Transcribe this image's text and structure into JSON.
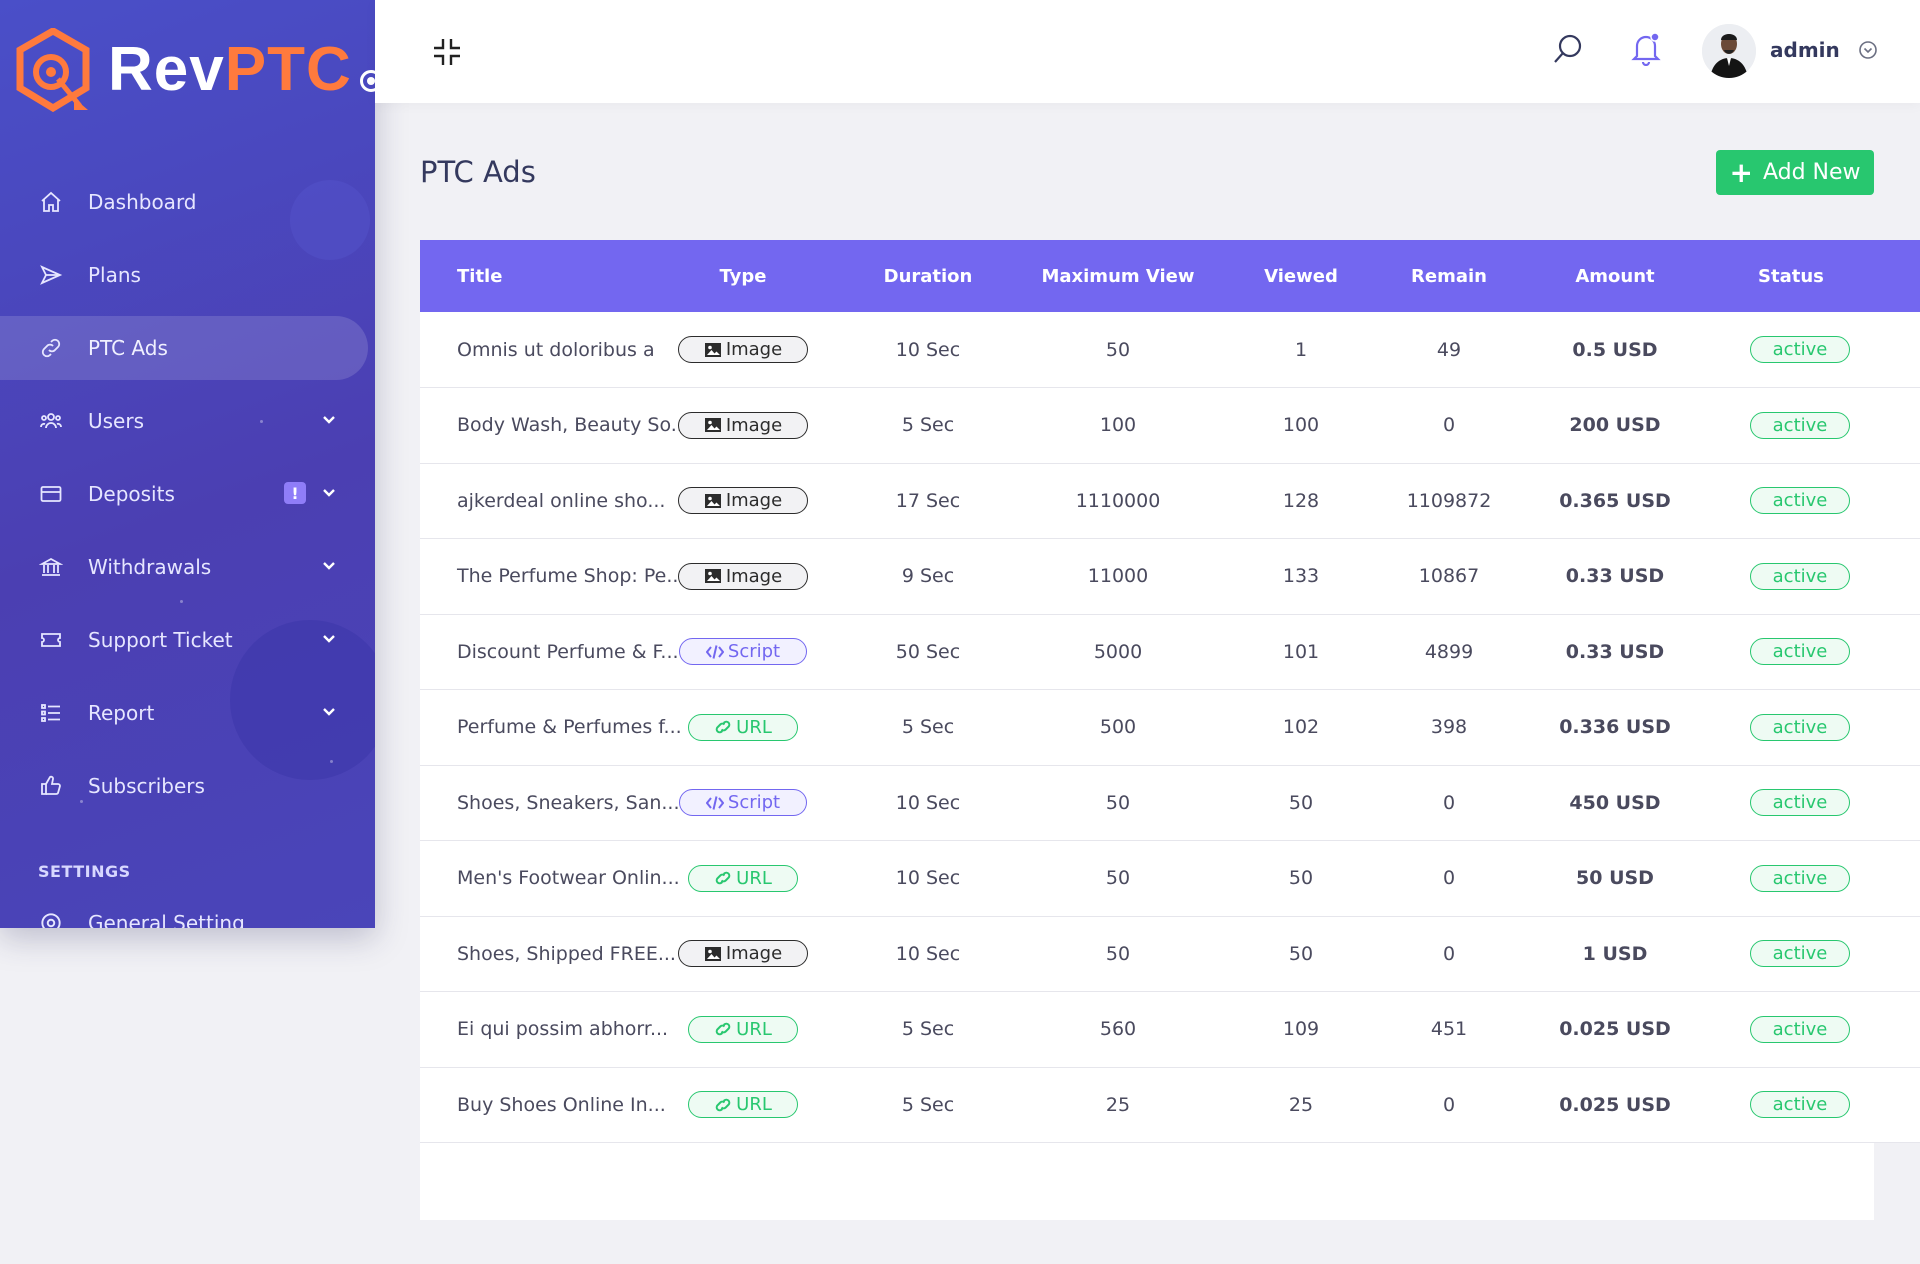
{
  "brand": {
    "rev": "Rev",
    "ptc": "PTC"
  },
  "sidebar": {
    "items": [
      {
        "label": "Dashboard",
        "icon": "home-icon",
        "active": false,
        "has_submenu": false
      },
      {
        "label": "Plans",
        "icon": "send-icon",
        "active": false,
        "has_submenu": false
      },
      {
        "label": "PTC Ads",
        "icon": "link-icon",
        "active": true,
        "has_submenu": false
      },
      {
        "label": "Users",
        "icon": "users-icon",
        "active": false,
        "has_submenu": true
      },
      {
        "label": "Deposits",
        "icon": "credit-card-icon",
        "active": false,
        "has_submenu": true,
        "alert": "!"
      },
      {
        "label": "Withdrawals",
        "icon": "bank-icon",
        "active": false,
        "has_submenu": true
      },
      {
        "label": "Support Ticket",
        "icon": "ticket-icon",
        "active": false,
        "has_submenu": true
      },
      {
        "label": "Report",
        "icon": "list-icon",
        "active": false,
        "has_submenu": true
      },
      {
        "label": "Subscribers",
        "icon": "thumbs-up-icon",
        "active": false,
        "has_submenu": false
      }
    ],
    "settings_label": "SETTINGS",
    "settings_items": [
      {
        "label": "General Setting",
        "icon": "settings-icon"
      }
    ]
  },
  "topbar": {
    "user_name": "admin"
  },
  "page": {
    "title": "PTC Ads",
    "add_button": "Add New"
  },
  "table": {
    "columns": [
      "Title",
      "Type",
      "Duration",
      "Maximum View",
      "Viewed",
      "Remain",
      "Amount",
      "Status"
    ],
    "rows": [
      {
        "title": "Omnis ut doloribus a",
        "type": "Image",
        "duration": "10 Sec",
        "max_view": "50",
        "viewed": "1",
        "remain": "49",
        "amount": "0.5 USD",
        "status": "active"
      },
      {
        "title": "Body Wash, Beauty So...",
        "type": "Image",
        "duration": "5 Sec",
        "max_view": "100",
        "viewed": "100",
        "remain": "0",
        "amount": "200 USD",
        "status": "active"
      },
      {
        "title": "ajkerdeal online sho...",
        "type": "Image",
        "duration": "17 Sec",
        "max_view": "1110000",
        "viewed": "128",
        "remain": "1109872",
        "amount": "0.365 USD",
        "status": "active"
      },
      {
        "title": "The Perfume Shop: Pe...",
        "type": "Image",
        "duration": "9 Sec",
        "max_view": "11000",
        "viewed": "133",
        "remain": "10867",
        "amount": "0.33 USD",
        "status": "active"
      },
      {
        "title": "Discount Perfume & F...",
        "type": "Script",
        "duration": "50 Sec",
        "max_view": "5000",
        "viewed": "101",
        "remain": "4899",
        "amount": "0.33 USD",
        "status": "active"
      },
      {
        "title": "Perfume & Perfumes f...",
        "type": "URL",
        "duration": "5 Sec",
        "max_view": "500",
        "viewed": "102",
        "remain": "398",
        "amount": "0.336 USD",
        "status": "active"
      },
      {
        "title": "Shoes, Sneakers, San...",
        "type": "Script",
        "duration": "10 Sec",
        "max_view": "50",
        "viewed": "50",
        "remain": "0",
        "amount": "450 USD",
        "status": "active"
      },
      {
        "title": "Men's Footwear Onlin...",
        "type": "URL",
        "duration": "10 Sec",
        "max_view": "50",
        "viewed": "50",
        "remain": "0",
        "amount": "50 USD",
        "status": "active"
      },
      {
        "title": "Shoes, Shipped FREE...",
        "type": "Image",
        "duration": "10 Sec",
        "max_view": "50",
        "viewed": "50",
        "remain": "0",
        "amount": "1 USD",
        "status": "active"
      },
      {
        "title": "Ei qui possim abhorr...",
        "type": "URL",
        "duration": "5 Sec",
        "max_view": "560",
        "viewed": "109",
        "remain": "451",
        "amount": "0.025 USD",
        "status": "active"
      },
      {
        "title": "Buy Shoes Online In...",
        "type": "URL",
        "duration": "5 Sec",
        "max_view": "25",
        "viewed": "25",
        "remain": "0",
        "amount": "0.025 USD",
        "status": "active"
      }
    ]
  },
  "colors": {
    "sidebar": "#4b3fb2",
    "accent": "#7367f0",
    "success": "#28c76f",
    "brand_orange": "#ff7a3d"
  }
}
